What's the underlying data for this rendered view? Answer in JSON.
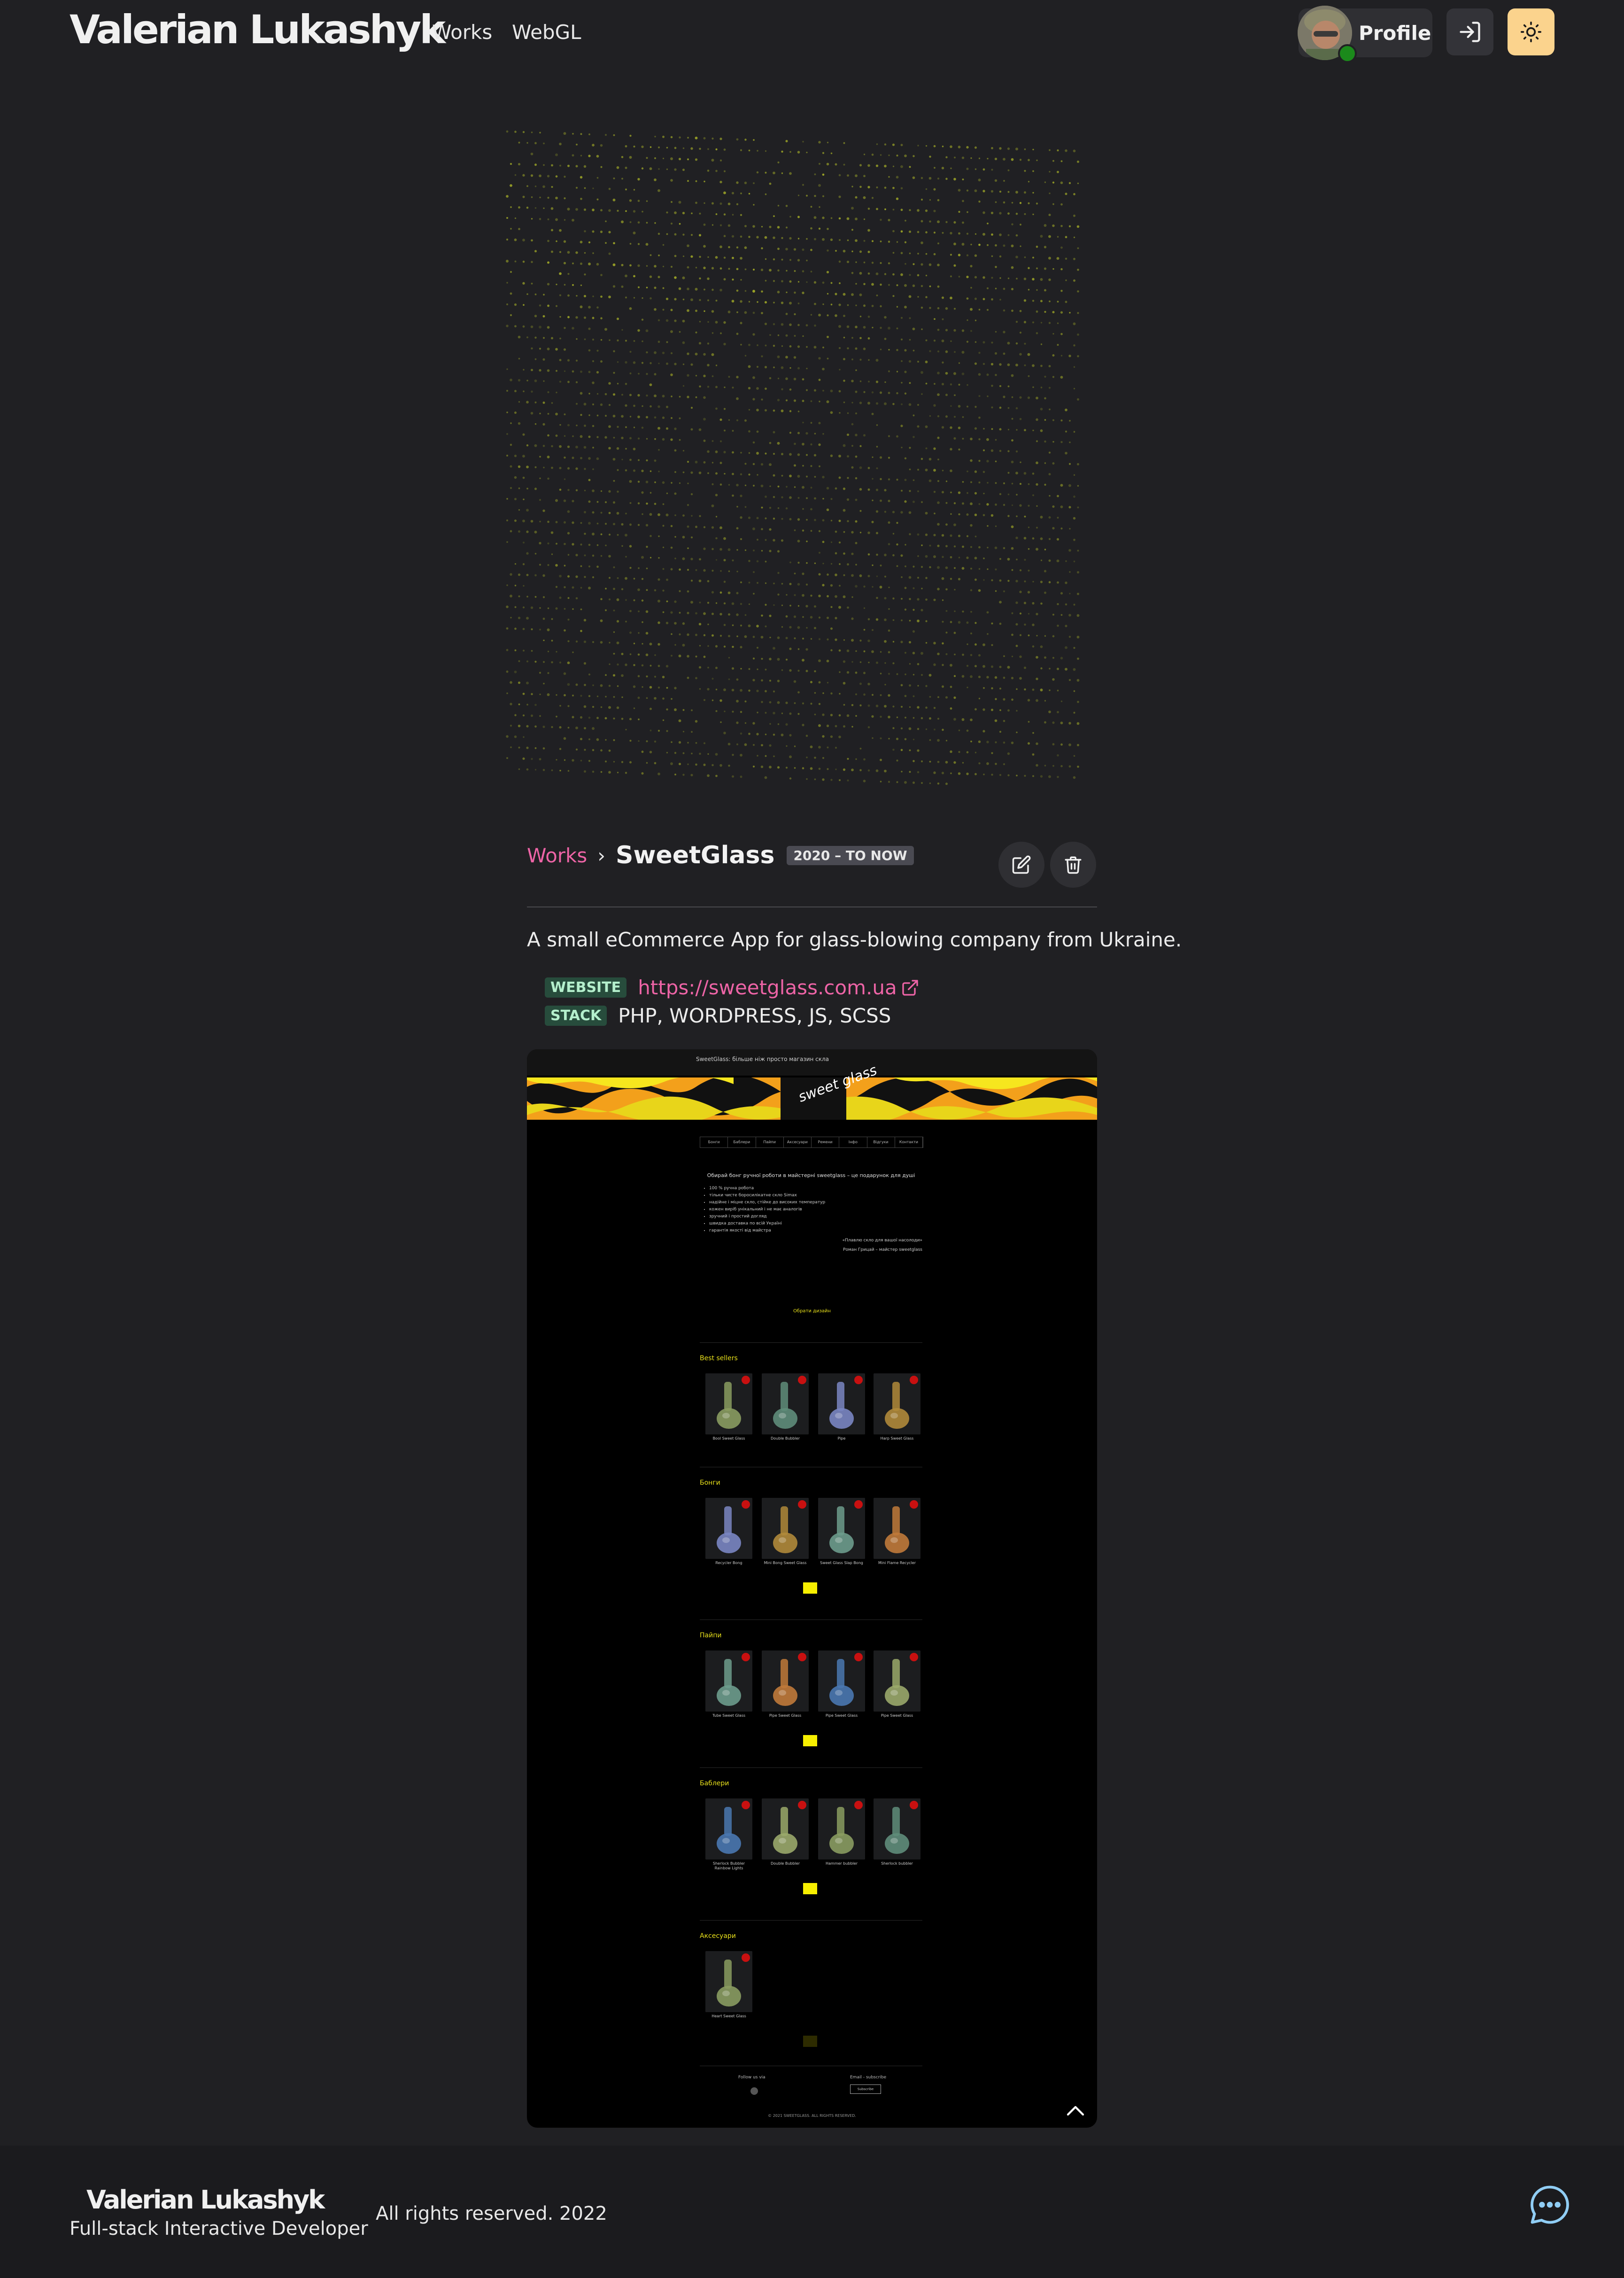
{
  "header": {
    "brand": "Valerian Lukashyk",
    "nav": [
      {
        "label": "Works"
      },
      {
        "label": "WebGL"
      }
    ],
    "profile_label": "Profile",
    "accent_color": "#fbd38d"
  },
  "article": {
    "breadcrumb": "Works",
    "title": "SweetGlass",
    "period": "2020 – TO NOW",
    "description": "A small eCommerce App for glass-blowing company from Ukraine.",
    "website_label": "WEBSITE",
    "website_url": "https://sweetglass.com.ua",
    "stack_label": "STACK",
    "stack": "PHP, WORDPRESS, JS, SCSS",
    "link_color": "#ed64a6"
  },
  "screenshot": {
    "topbar": "SweetGlass: більше ніж просто магазин скла",
    "logo": "sweet glass",
    "menu": [
      "Бонги",
      "Баблери",
      "Пайпи",
      "Аксесуари",
      "Ремени",
      "Інфо",
      "Відгуки",
      "Контакти"
    ],
    "intro_title": "Обирай бонг ручної роботи  в майстерні sweetglass – це подарунок для душі",
    "bullets": [
      "100 % ручна робота",
      "тільки чисте боросилікатне скло Simax",
      "надійне і міцне скло, стійке до високих температур",
      "кожен виріб унікальний і не має аналогів",
      "зручний і простий догляд",
      "швидка доставка по всій Україні",
      "гарантія якості від майстра"
    ],
    "quote": "«Плавлю скло для вашої насолоди»",
    "quote_author": "Роман Грицай – майстер sweetglass",
    "choose": "Обрати дизайн",
    "sections": [
      {
        "title": "Best sellers",
        "products": [
          "Bool Sweet Glass",
          "Double Bubbler",
          "Pipe",
          "Harp Sweet Glass"
        ]
      },
      {
        "title": "Бонги",
        "products": [
          "Recycler Bong",
          "Mini Bong Sweet Glass",
          "Sweet Glass Slap Bong",
          "Mini Flame Recycler"
        ]
      },
      {
        "title": "Пайпи",
        "products": [
          "Tube Sweet Glass",
          "Pipe Sweet Glass",
          "Pipe Sweet Glass",
          "Pipe Sweet Glass"
        ]
      },
      {
        "title": "Баблери",
        "products": [
          "Sherlock Bubbler Rainbow Lights",
          "Double Bubbler",
          "Hammer bubbler",
          "Sherlock bubbler"
        ]
      },
      {
        "title": "Аксесуари",
        "products": [
          "Heart Sweet Glass"
        ]
      }
    ],
    "follow": "Follow us via",
    "email_label": "Email - subscribe",
    "subscribe": "Subscribe",
    "copyright": "© 2021 SWEETGLASS. ALL RIGHTS RESERVED."
  },
  "footer": {
    "brand": "Valerian Lukashyk",
    "role": "Full-stack Interactive Developer",
    "rights": "All rights reserved. 2022"
  }
}
